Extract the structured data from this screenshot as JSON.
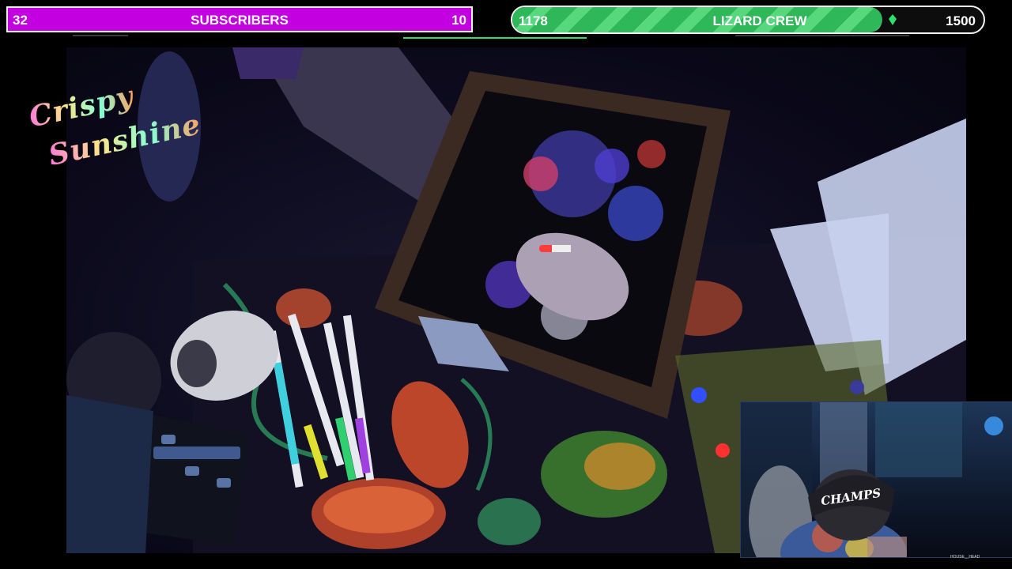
{
  "subscriber_goal": {
    "current": "32",
    "label": "SUBSCRIBERS",
    "target": "10",
    "color": "#c200e0"
  },
  "crew_goal": {
    "current": "1178",
    "label": "LIZARD CREW",
    "target": "1500",
    "progress": 0.785,
    "color": "#2fb85a",
    "icon": "gem-icon"
  },
  "logo": {
    "line1": "Crispy",
    "line2": "Sunshine"
  },
  "facecam": {
    "cap_text": "CHAMPS",
    "handle": "HOUSE__HEAD"
  }
}
